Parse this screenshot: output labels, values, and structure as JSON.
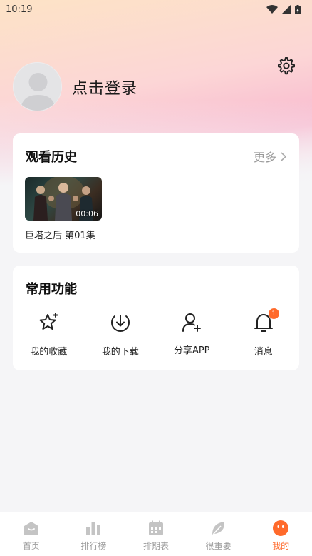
{
  "status_bar": {
    "time": "10:19"
  },
  "profile": {
    "login_text": "点击登录"
  },
  "history": {
    "title": "观看历史",
    "more_label": "更多",
    "items": [
      {
        "title": "巨塔之后 第01集",
        "duration": "00:06"
      }
    ]
  },
  "functions": {
    "title": "常用功能",
    "items": [
      {
        "label": "我的收藏",
        "icon": "star-sparkle-icon"
      },
      {
        "label": "我的下载",
        "icon": "download-icon"
      },
      {
        "label": "分享APP",
        "icon": "add-user-icon"
      },
      {
        "label": "消息",
        "icon": "bell-icon",
        "badge": "1"
      }
    ]
  },
  "tabs": [
    {
      "label": "首页",
      "icon": "home-icon",
      "active": false
    },
    {
      "label": "排行榜",
      "icon": "bar-chart-icon",
      "active": false
    },
    {
      "label": "排期表",
      "icon": "calendar-icon",
      "active": false
    },
    {
      "label": "很重要",
      "icon": "leaf-icon",
      "active": false
    },
    {
      "label": "我的",
      "icon": "face-icon",
      "active": true
    }
  ],
  "colors": {
    "accent": "#ff6a2b",
    "inactive": "#9a9a9a"
  }
}
